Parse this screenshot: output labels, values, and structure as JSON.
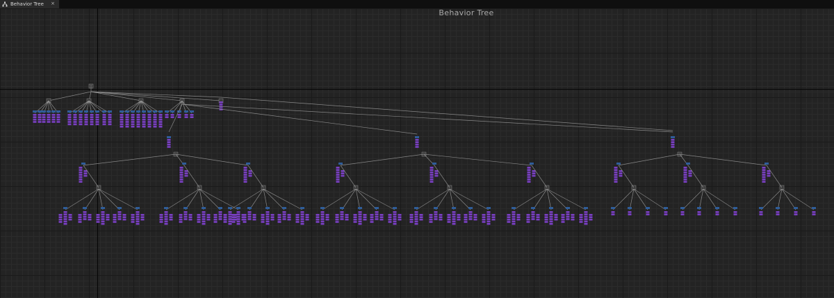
{
  "tab": {
    "label": "Behavior Tree",
    "close": "×",
    "icon": "behavior-tree-icon"
  },
  "graph": {
    "title": "Behavior Tree"
  },
  "colors": {
    "background": "#232323",
    "task_node": "#7a3fc4",
    "decorator_node": "#2f5d9a",
    "composite_node": "#3a3a3a",
    "wire": "#9a9a9a"
  }
}
